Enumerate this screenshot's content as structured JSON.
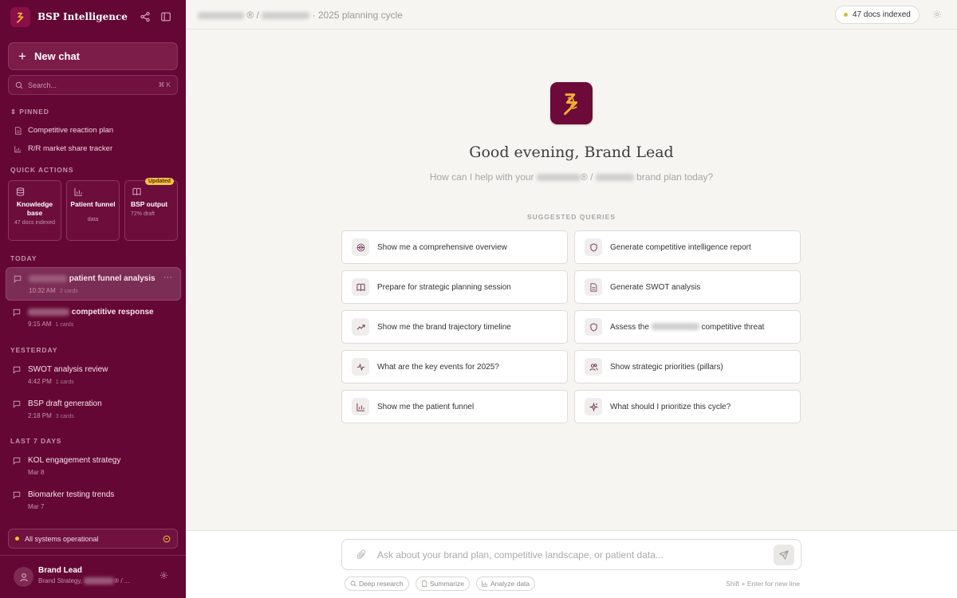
{
  "app": {
    "title": "BSP Intelligence"
  },
  "sidebar": {
    "new_chat_label": "New chat",
    "search": {
      "placeholder": "Search...",
      "shortcut": "⌘ K"
    },
    "pinned_label": "PINNED",
    "pinned": [
      {
        "label": "Competitive reaction plan",
        "icon": "document-icon"
      },
      {
        "label": "R/R market share tracker",
        "icon": "bar-chart-icon"
      }
    ],
    "quick_actions_label": "QUICK ACTIONS",
    "quick_actions": [
      {
        "title": "Knowledge base",
        "sub": "47 docs indexed",
        "icon": "database-icon"
      },
      {
        "title": "Patient funnel",
        "sub": "data",
        "icon": "bar-chart-icon"
      },
      {
        "title": "BSP output",
        "sub": "72% draft",
        "icon": "book-icon",
        "badge": "Updated"
      }
    ],
    "groups": {
      "today": "TODAY",
      "yesterday": "YESTERDAY",
      "last7": "LAST 7 DAYS"
    },
    "chats": [
      {
        "title": "patient funnel analysis",
        "time": "10:32 AM",
        "cards": "2 cards",
        "redacted": true,
        "active": true
      },
      {
        "title": "competitive response",
        "time": "9:15 AM",
        "cards": "1 cards",
        "redacted": true
      },
      {
        "title": "SWOT analysis review",
        "time": "4:42 PM",
        "cards": "1 cards"
      },
      {
        "title": "BSP draft generation",
        "time": "2:18 PM",
        "cards": "3 cards"
      },
      {
        "title": "KOL engagement strategy",
        "time": "Mar 8",
        "cards": ""
      },
      {
        "title": "Biomarker testing trends",
        "time": "Mar 7",
        "cards": ""
      }
    ],
    "status": "All systems operational",
    "user": {
      "name": "Brand Lead",
      "role": "Brand Strategy,",
      "role_tail": "® / ..."
    }
  },
  "topbar": {
    "breadcrumb_sep": "®  /",
    "breadcrumb_tail": "· 2025 planning cycle",
    "docs_indexed": "47 docs indexed"
  },
  "main": {
    "greeting": "Good evening, Brand Lead",
    "sub_prefix": "How can I help with your",
    "sub_mid": "® /",
    "sub_suffix": "brand plan today?",
    "suggested_label": "SUGGESTED QUERIES",
    "queries": [
      {
        "label": "Show me a comprehensive overview",
        "icon": "globe-icon"
      },
      {
        "label": "Generate competitive intelligence report",
        "icon": "shield-icon"
      },
      {
        "label": "Prepare for strategic planning session",
        "icon": "book-icon"
      },
      {
        "label": "Generate SWOT analysis",
        "icon": "document-icon"
      },
      {
        "label": "Show me the brand trajectory timeline",
        "icon": "trend-icon"
      },
      {
        "label_prefix": "Assess the",
        "label_suffix": "competitive threat",
        "icon": "shield-icon"
      },
      {
        "label": "What are the key events for 2025?",
        "icon": "pulse-icon"
      },
      {
        "label": "Show strategic priorities (pillars)",
        "icon": "users-icon"
      },
      {
        "label": "Show me the patient funnel",
        "icon": "bar-chart-icon"
      },
      {
        "label": "What should I prioritize this cycle?",
        "icon": "sparkle-icon"
      }
    ]
  },
  "composer": {
    "placeholder": "Ask about your brand plan, competitive landscape, or patient data...",
    "chips": [
      {
        "label": "Deep research",
        "icon": "search-icon"
      },
      {
        "label": "Summarize",
        "icon": "document-icon"
      },
      {
        "label": "Analyze data",
        "icon": "bar-chart-icon"
      }
    ],
    "hint": "Shift + Enter for new line"
  },
  "colors": {
    "sidebar_bg": "#650734",
    "accent": "#f0c22d",
    "brand": "#6d0a3a"
  }
}
